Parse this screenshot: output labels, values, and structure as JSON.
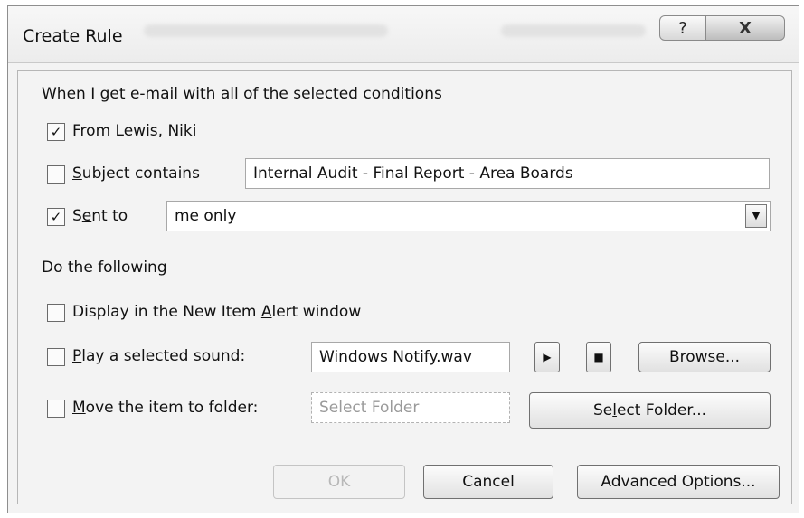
{
  "window": {
    "title": "Create Rule",
    "help_icon": "?",
    "close_icon": "X"
  },
  "conditions": {
    "heading": "When I get e-mail with all of the selected conditions",
    "from": {
      "checked": true,
      "label_first": "F",
      "label_rest": "rom Lewis, Niki"
    },
    "subject": {
      "checked": false,
      "label_first": "S",
      "label_rest": "ubject contains",
      "value": "Internal Audit - Final Report - Area Boards"
    },
    "sent_to": {
      "checked": true,
      "label_a": "S",
      "label_u": "e",
      "label_b": "nt to",
      "value": "me only"
    }
  },
  "actions": {
    "heading": "Do the following",
    "alert": {
      "checked": false,
      "label_a": "Display in the New Item ",
      "label_u": "A",
      "label_b": "lert window"
    },
    "sound": {
      "checked": false,
      "label_first": "P",
      "label_rest": "lay a selected sound:",
      "value": "Windows Notify.wav",
      "play_icon": "▶",
      "stop_icon": "■",
      "browse_a": "Bro",
      "browse_u": "w",
      "browse_b": "se..."
    },
    "move": {
      "checked": false,
      "label_first": "M",
      "label_rest": "ove the item to folder:",
      "placeholder": "Select Folder",
      "select_a": "Se",
      "select_u": "l",
      "select_b": "ect Folder..."
    }
  },
  "footer": {
    "ok": "OK",
    "cancel": "Cancel",
    "advanced": "Advanced Options..."
  },
  "check_mark": "✓"
}
